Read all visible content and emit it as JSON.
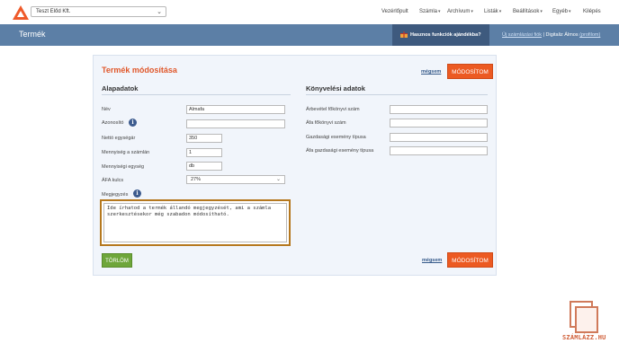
{
  "topnav": {
    "company": "Teszt Előd Kft.",
    "menu": [
      {
        "label": "Vezérlőpult",
        "dropdown": false
      },
      {
        "label": "Számla",
        "dropdown": true
      },
      {
        "label": "Archívum",
        "dropdown": true
      },
      {
        "label": "Listák",
        "dropdown": true
      },
      {
        "label": "Beállítások",
        "dropdown": true
      },
      {
        "label": "Egyéb",
        "dropdown": true
      },
      {
        "label": "Kilépés",
        "dropdown": false
      }
    ]
  },
  "titlebar": {
    "title": "Termék",
    "promo": "Hasznos funkciók ajándékba?",
    "new_invoice_link": "Új számlázási fiók",
    "separator": "|",
    "user_name": "Digitaliz Álmos",
    "profile_link": "(profilom)"
  },
  "form": {
    "title": "Termék módosítása",
    "cancel_label": "mégsem",
    "save_label": "MÓDOSÍTOM",
    "delete_label": "TÖRLÖM",
    "basic_section": "Alapadatok",
    "accounting_section": "Könyvelési adatok",
    "fields": {
      "name": {
        "label": "Név",
        "value": "Almafa"
      },
      "id": {
        "label": "Azonosító",
        "value": ""
      },
      "net_price": {
        "label": "Nettó egységár",
        "value": "350"
      },
      "quantity": {
        "label": "Mennyiség a számlán",
        "value": "1"
      },
      "unit": {
        "label": "Mennyiségi egység",
        "value": "db"
      },
      "vat": {
        "label": "ÁFA kulcs",
        "value": "27%"
      },
      "note": {
        "label": "Megjegyzés",
        "value": "Ide írhatod a termék állandó megjegyzését, ami a számla szerkesztésekor még szabadon módosítható."
      }
    },
    "accounting": {
      "revenue": {
        "label": "Árbevétel főkönyvi szám",
        "value": ""
      },
      "vat_ledger": {
        "label": "Áfa főkönyvi szám",
        "value": ""
      },
      "event_type": {
        "label": "Gazdasági esemény típusa",
        "value": ""
      },
      "vat_event_type": {
        "label": "Áfa gazdasági esemény típusa",
        "value": ""
      }
    },
    "info_icon": "i"
  },
  "watermark": {
    "brand": "SZÁMLÁZZ.HU"
  },
  "icons": {
    "logo": "szamlazz-logo-icon",
    "company_chevron": "chevron-down-icon",
    "promo": "gift-icon",
    "info": "info-icon"
  },
  "colors": {
    "accent": "#ec5a22",
    "title_bar": "#5c7fa6",
    "promo_bg": "#3e5a7e",
    "delete": "#6ea63a",
    "card_bg": "#f1f5fb",
    "note_border": "#b5781e"
  }
}
